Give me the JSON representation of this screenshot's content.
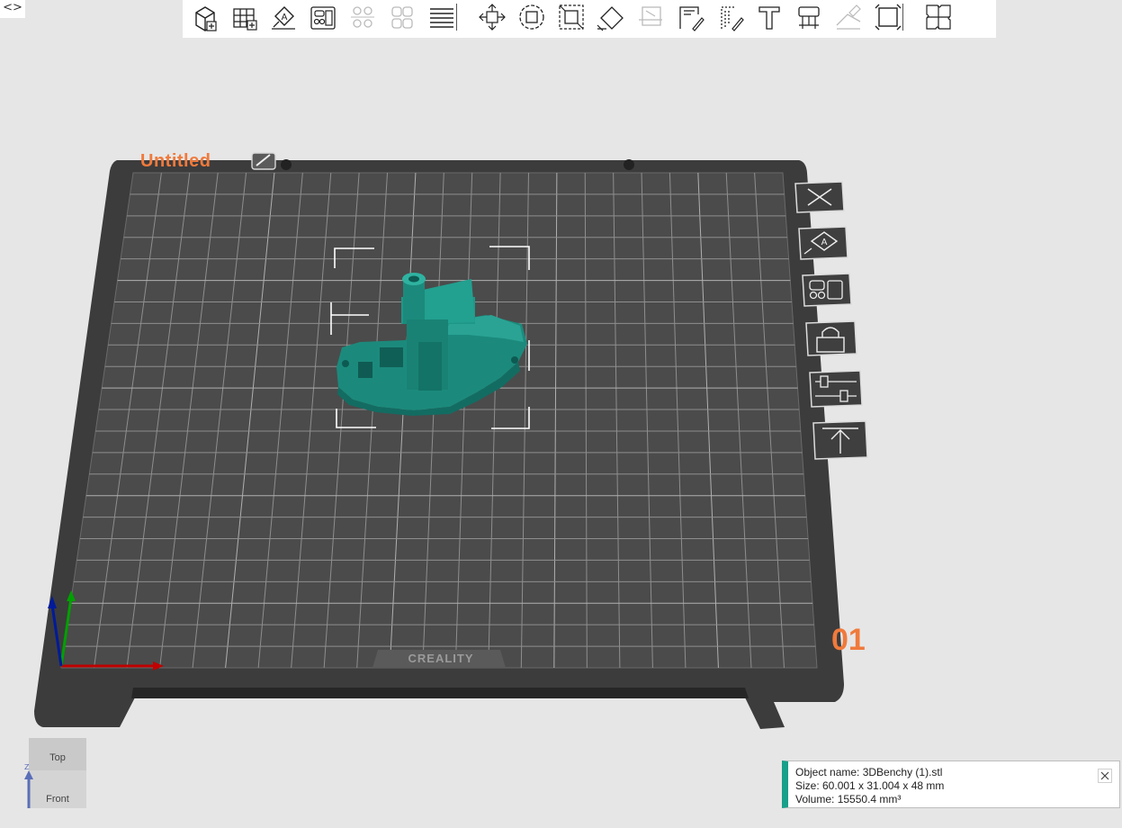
{
  "window": {
    "collapse_glyph": "<>"
  },
  "toolbar": {
    "groups": [
      [
        "add-object-icon",
        "add-plate-icon",
        "auto-arrange-icon",
        "plate-layout-icon",
        "duplicate-icon",
        "split-icon",
        "layers-icon"
      ],
      [
        "move-icon",
        "rotate-icon",
        "scale-icon",
        "lay-flat-icon",
        "cut-icon",
        "seam-paint-icon",
        "support-paint-icon",
        "text-icon",
        "measure-icon",
        "color-paint-icon",
        "boolean-icon"
      ],
      [
        "assembly-icon"
      ]
    ]
  },
  "plate": {
    "title": "Untitled",
    "number": "01",
    "brand": "CREALITY",
    "colors": {
      "surface": "#4a4a4a",
      "frame": "#3b3b3b",
      "grid": "#8c8c8c",
      "title": "#f07a3c",
      "model": "#1b8a7c"
    }
  },
  "plate_actions": [
    "close-plate-icon",
    "auto-arrange-plate-icon",
    "plate-layout-icon",
    "lock-plate-icon",
    "plate-settings-icon",
    "move-to-top-icon"
  ],
  "view_cube": {
    "top": "Top",
    "front": "Front",
    "axis_label": "Z"
  },
  "object_info": {
    "name_line": "Object name: 3DBenchy (1).stl",
    "size_line": "Size: 60.001 x 31.004 x 48 mm",
    "volume_line": "Volume: 15550.4 mm³"
  }
}
